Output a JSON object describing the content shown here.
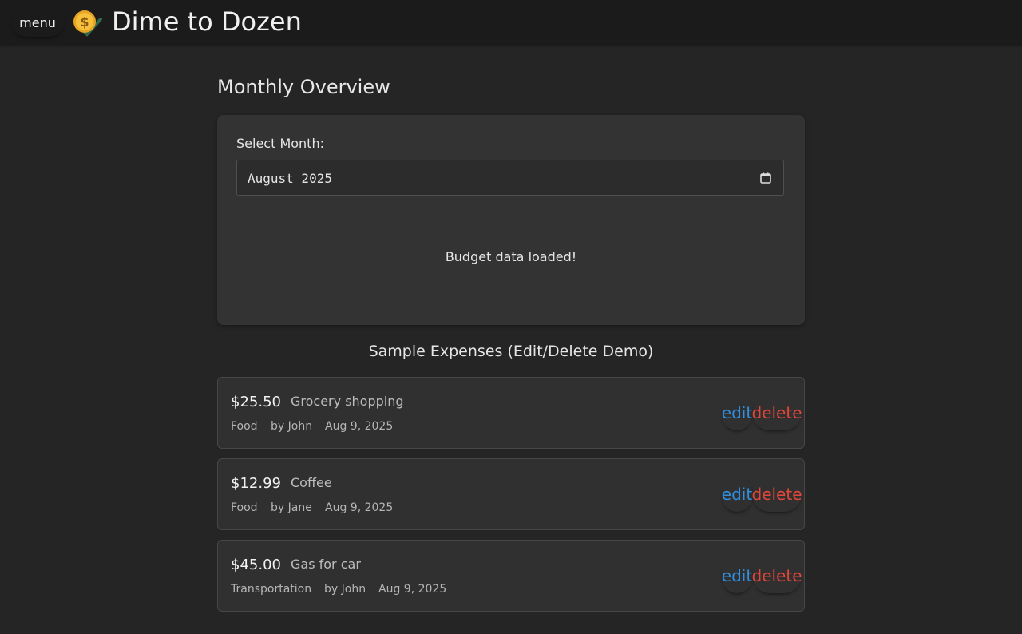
{
  "header": {
    "menu_label": "menu",
    "app_title": "Dime to Dozen",
    "logo_icon": "coin-check-icon"
  },
  "overview": {
    "heading": "Monthly Overview",
    "select_label": "Select Month:",
    "month_value": "August 2025",
    "status": "Budget data loaded!"
  },
  "expenses_section": {
    "heading": "Sample Expenses (Edit/Delete Demo)",
    "edit_label": "edit",
    "delete_label": "delete",
    "items": [
      {
        "amount": "$25.50",
        "description": "Grocery shopping",
        "category": "Food",
        "by": "by John",
        "date": "Aug 9, 2025"
      },
      {
        "amount": "$12.99",
        "description": "Coffee",
        "category": "Food",
        "by": "by Jane",
        "date": "Aug 9, 2025"
      },
      {
        "amount": "$45.00",
        "description": "Gas for car",
        "category": "Transportation",
        "by": "by John",
        "date": "Aug 9, 2025"
      }
    ]
  },
  "colors": {
    "accent_edit": "#2f8fe0",
    "accent_delete": "#e2473a",
    "background": "#252525",
    "topbar": "#1b1b1b"
  }
}
